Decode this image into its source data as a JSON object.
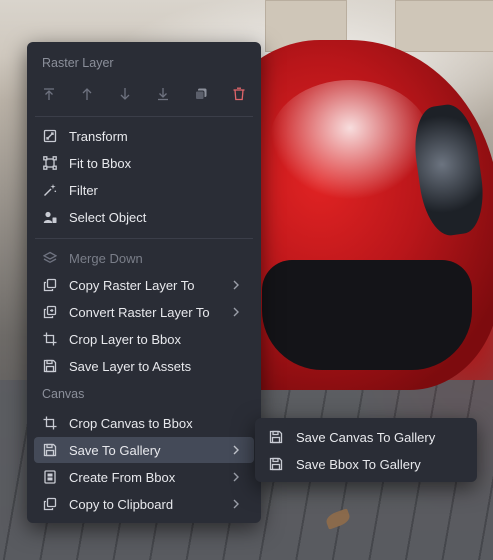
{
  "raster_section": {
    "title": "Raster Layer",
    "icons": [
      "move-to-top-icon",
      "move-up-icon",
      "move-down-icon",
      "move-to-bottom-icon",
      "duplicate-icon",
      "delete-icon"
    ],
    "items": [
      {
        "label": "Transform",
        "icon": "transform-icon"
      },
      {
        "label": "Fit to Bbox",
        "icon": "fit-bbox-icon"
      },
      {
        "label": "Filter",
        "icon": "magic-wand-icon"
      },
      {
        "label": "Select Object",
        "icon": "select-object-icon"
      }
    ],
    "items2": [
      {
        "label": "Merge Down",
        "icon": "stack-icon",
        "disabled": true
      },
      {
        "label": "Copy Raster Layer To",
        "icon": "copy-icon",
        "submenu": true
      },
      {
        "label": "Convert Raster Layer To",
        "icon": "convert-icon",
        "submenu": true
      },
      {
        "label": "Crop Layer to Bbox",
        "icon": "crop-icon"
      },
      {
        "label": "Save Layer to Assets",
        "icon": "floppy-icon"
      }
    ]
  },
  "canvas_section": {
    "title": "Canvas",
    "items": [
      {
        "label": "Crop Canvas to Bbox",
        "icon": "crop-icon"
      },
      {
        "label": "Save To Gallery",
        "icon": "floppy-icon",
        "submenu": true,
        "highlighted": true
      },
      {
        "label": "Create From Bbox",
        "icon": "create-bbox-icon",
        "submenu": true
      },
      {
        "label": "Copy to Clipboard",
        "icon": "copy-icon",
        "submenu": true
      }
    ]
  },
  "submenu": {
    "items": [
      {
        "label": "Save Canvas To Gallery",
        "icon": "floppy-icon"
      },
      {
        "label": "Save Bbox To Gallery",
        "icon": "floppy-icon"
      }
    ]
  },
  "colors": {
    "menu_bg": "#2a2d36",
    "highlight_bg": "#444a58",
    "delete_accent": "#e0656a"
  }
}
